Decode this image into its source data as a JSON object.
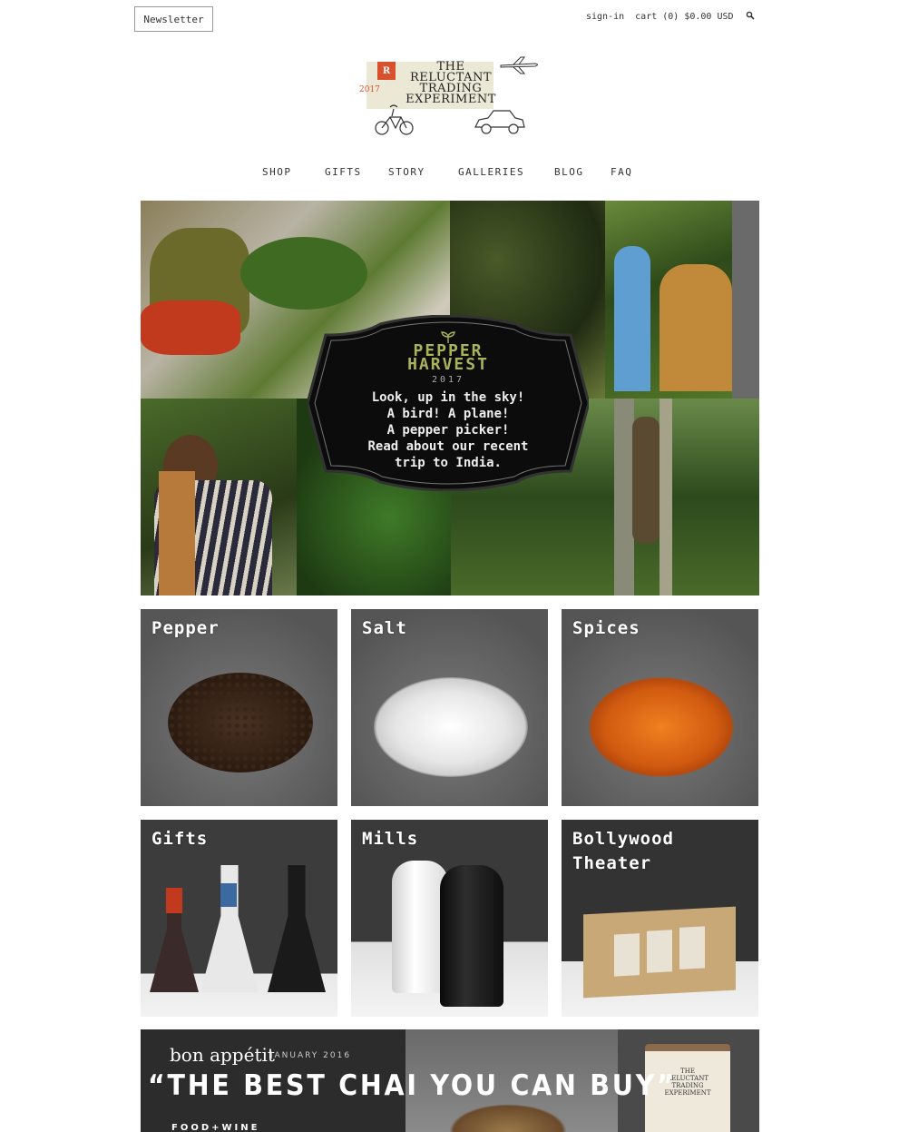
{
  "header": {
    "newsletter_label": "Newsletter",
    "signin_label": "sign-in",
    "cart_label": "cart (0) $0.00 USD"
  },
  "logo": {
    "text_lines": "THE\nRELUCTANT\nTRADING\nEXPERIMENT",
    "year": "2017",
    "badge_letter": "R"
  },
  "nav": {
    "items": [
      "SHOP",
      "GIFTS",
      "STORY",
      "GALLERIES",
      "BLOG",
      "FAQ"
    ]
  },
  "hero": {
    "badge_title_1": "PEPPER",
    "badge_title_2": "HARVEST",
    "badge_year": "2017",
    "badge_body": "Look, up in the sky!\nA bird! A plane!\nA pepper picker!\nRead about our recent\ntrip to India."
  },
  "categories": [
    {
      "label": "Pepper"
    },
    {
      "label": "Salt"
    },
    {
      "label": "Spices"
    },
    {
      "label": "Gifts"
    },
    {
      "label": "Mills"
    },
    {
      "label": "Bollywood\nTheater"
    }
  ],
  "press": {
    "magazine": "bon appétit",
    "date": "JANUARY 2016",
    "quote": "“THE BEST CHAI YOU CAN BUY”",
    "sub": "FOOD+WINE"
  },
  "colors": {
    "accent": "#d8502c",
    "badge_title": "#a9b45a"
  }
}
